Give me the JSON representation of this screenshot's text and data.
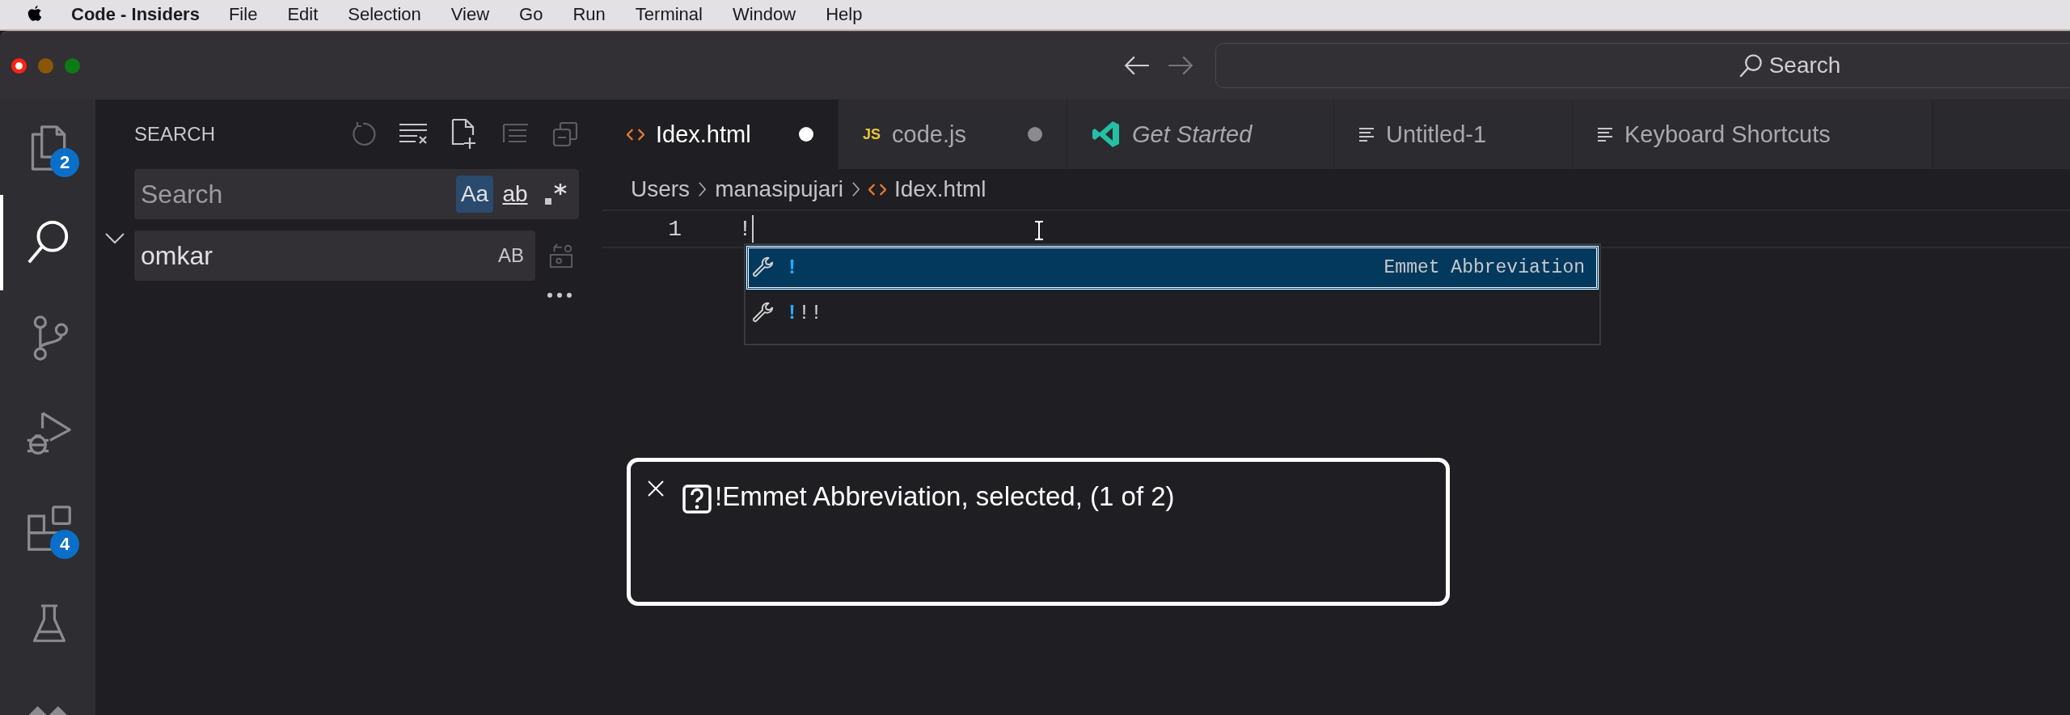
{
  "menu_bar": {
    "app_name": "Code - Insiders",
    "items": [
      "File",
      "Edit",
      "Selection",
      "View",
      "Go",
      "Run",
      "Terminal",
      "Window",
      "Help"
    ]
  },
  "title_bar": {
    "search": {
      "placeholder": "Search"
    }
  },
  "activity_bar": {
    "items": [
      {
        "kind": "files",
        "badge": "2",
        "selected": false
      },
      {
        "kind": "search",
        "selected": true
      },
      {
        "kind": "source-control",
        "selected": false
      },
      {
        "kind": "run-debug",
        "selected": false
      },
      {
        "kind": "extensions",
        "badge": "4",
        "selected": false
      },
      {
        "kind": "testing",
        "selected": false
      },
      {
        "kind": "remote",
        "selected": false
      }
    ]
  },
  "sidebar": {
    "title": "SEARCH",
    "expanded": true,
    "search_field": {
      "placeholder": "Search",
      "options": [
        {
          "kind": "match-case",
          "label": "Aa",
          "selected": true
        },
        {
          "kind": "whole-word",
          "label": "ab",
          "selected": false
        },
        {
          "kind": "regex",
          "selected": false
        }
      ]
    },
    "replace_field": {
      "value": "omkar",
      "preserve_case": "AB"
    }
  },
  "editor": {
    "tabs": [
      {
        "label": "Idex.html",
        "kind": "html",
        "selected": true,
        "modified": true,
        "preview": false
      },
      {
        "label": "code.js",
        "kind": "js",
        "icon_label": "JS",
        "selected": false,
        "modified": true,
        "preview": false
      },
      {
        "label": "Get Started",
        "kind": "welcome",
        "selected": false,
        "modified": false,
        "preview": true
      },
      {
        "label": "Untitled-1",
        "kind": "text",
        "selected": false,
        "modified": false,
        "preview": false
      },
      {
        "label": "Keyboard Shortcuts",
        "kind": "text",
        "selected": false,
        "modified": false,
        "preview": false
      }
    ],
    "breadcrumbs": [
      {
        "label": "Users",
        "kind": "folder"
      },
      {
        "label": "manasipujari",
        "kind": "folder"
      },
      {
        "label": "Idex.html",
        "kind": "html"
      }
    ],
    "lines": [
      {
        "number": "1",
        "text": "!"
      }
    ],
    "suggestions": [
      {
        "matched": "!",
        "detail": "Emmet Abbreviation",
        "selected": true
      },
      {
        "matched": "!",
        "rest": "!!",
        "selected": false
      }
    ]
  },
  "announcement": {
    "text": "!Emmet Abbreviation, selected, (1 of 2)"
  }
}
